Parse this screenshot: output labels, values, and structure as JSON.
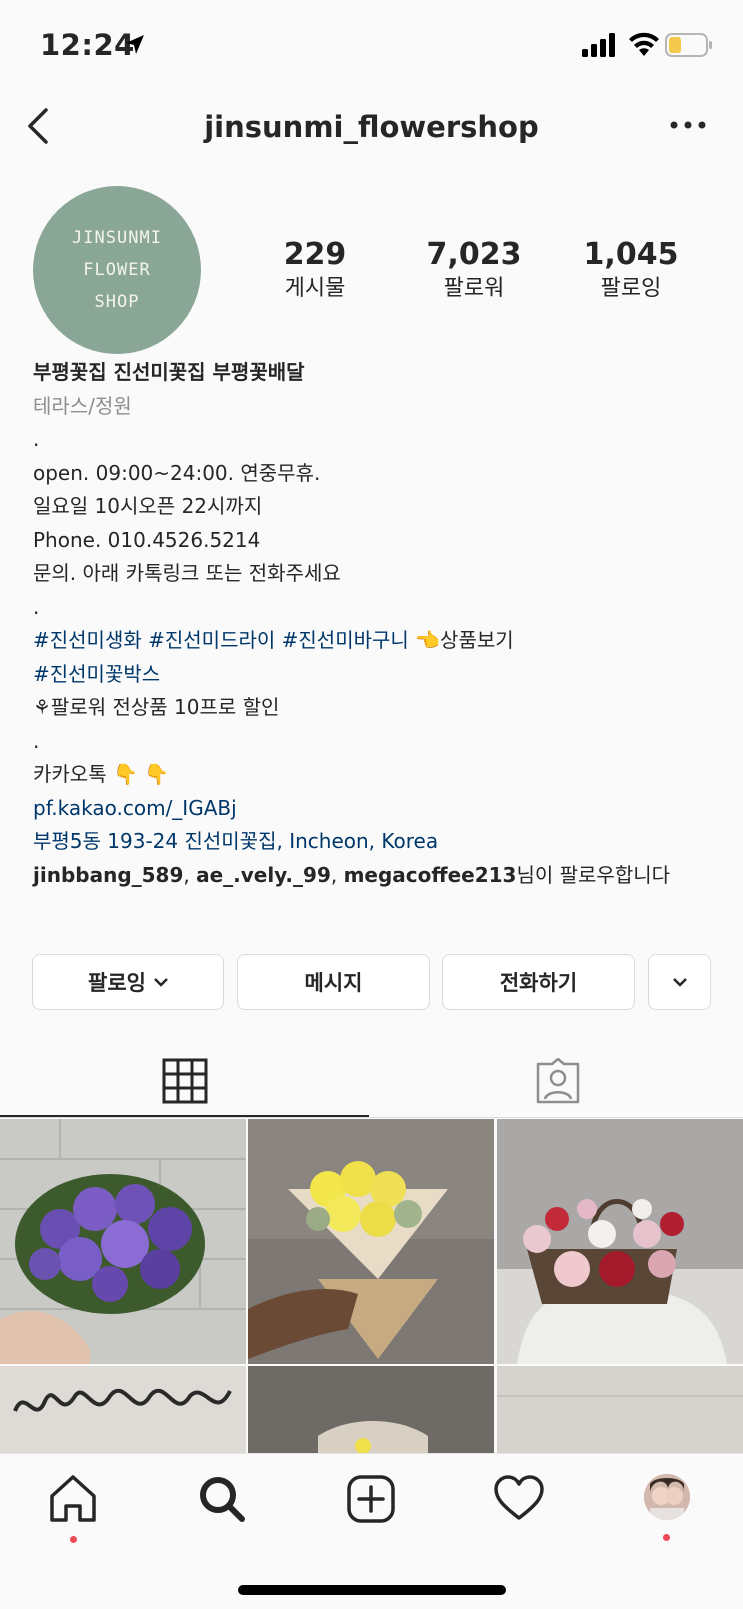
{
  "status_bar": {
    "time": "12:24"
  },
  "header": {
    "username": "jinsunmi_flowershop"
  },
  "profile": {
    "avatar_lines": [
      "JINSUNMI",
      "FLOWER",
      "SHOP"
    ],
    "stats": [
      {
        "value": "229",
        "label": "게시물"
      },
      {
        "value": "7,023",
        "label": "팔로워"
      },
      {
        "value": "1,045",
        "label": "팔로잉"
      }
    ]
  },
  "bio": {
    "name": "부평꽃집 진선미꽃집 부평꽃배달",
    "category": "테라스/정원",
    "lines": [
      ".",
      "open. 09:00~24:00. 연중무휴.",
      "일요일 10시오픈 22시까지",
      "Phone. 010.4526.5214",
      "문의. 아래 카톡링크 또는 전화주세요",
      "."
    ],
    "hashtags_line1": "#진선미생화 #진선미드라이 #진선미바구니",
    "hashtags_line1_suffix": "👈상품보기",
    "hashtags_line2": "#진선미꽃박스",
    "discount": "⚘팔로워 전상품 10프로 할인",
    "dot2": ".",
    "kakao": "카카오톡 👇 👇",
    "kakao_link": "pf.kakao.com/_IGABj",
    "address": "부평5동 193-24 진선미꽃집, Incheon, Korea",
    "followed_by_names": "jinbbang_589",
    "followed_by_sep1": ", ",
    "followed_by_name2": "ae_.vely._99",
    "followed_by_sep2": ", ",
    "followed_by_name3": "megacoffee213",
    "followed_by_suffix": "님이 팔로우합니다"
  },
  "buttons": {
    "following": "팔로잉",
    "message": "메시지",
    "call": "전화하기"
  },
  "grid_tiles": [
    {
      "subject": "purple freesia bouquet"
    },
    {
      "subject": "yellow flower bouquet"
    },
    {
      "subject": "flower basket"
    },
    {
      "subject": "jinsunmi lettering"
    },
    {
      "subject": "bouquet"
    },
    {
      "subject": "wall"
    }
  ],
  "colors": {
    "link": "#00376b",
    "notification_dot": "#ed4956",
    "avatar_bg": "#8aa696"
  }
}
